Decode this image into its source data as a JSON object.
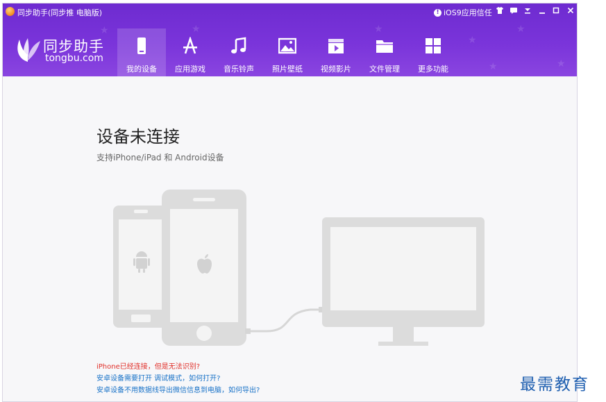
{
  "window": {
    "title": "同步助手(同步推 电脑版)",
    "trust_label": "iOS9应用信任",
    "controls": [
      "tshirt-icon",
      "message-icon",
      "download-icon",
      "minimize-icon",
      "maximize-icon",
      "close-icon"
    ]
  },
  "logo": {
    "name_cn": "同步助手",
    "name_en": "tongbu.com"
  },
  "nav": [
    {
      "label": "我的设备",
      "icon": "phone-icon",
      "active": true
    },
    {
      "label": "应用游戏",
      "icon": "app-store-icon",
      "active": false
    },
    {
      "label": "音乐铃声",
      "icon": "music-note-icon",
      "active": false
    },
    {
      "label": "照片壁纸",
      "icon": "picture-icon",
      "active": false
    },
    {
      "label": "视频影片",
      "icon": "video-clapper-icon",
      "active": false
    },
    {
      "label": "文件管理",
      "icon": "folder-icon",
      "active": false
    },
    {
      "label": "更多功能",
      "icon": "grid-icon",
      "active": false
    }
  ],
  "main": {
    "title": "设备未连接",
    "subtitle": "支持iPhone/iPad 和 Android设备",
    "links": [
      {
        "text": "iPhone已经连接，但是无法识别?",
        "color": "#e0302a"
      },
      {
        "text": "安卓设备需要打开 调试模式，如何打开?",
        "color": "#1a73c8"
      },
      {
        "text": "安卓设备不用数据线导出微信信息到电脑，如何导出?",
        "color": "#1a73c8"
      }
    ]
  },
  "watermark": "最需教育",
  "colors": {
    "header": "#7a34da",
    "illustration": "#dcdcdc",
    "link_red": "#e0302a",
    "link_blue": "#1a73c8"
  }
}
